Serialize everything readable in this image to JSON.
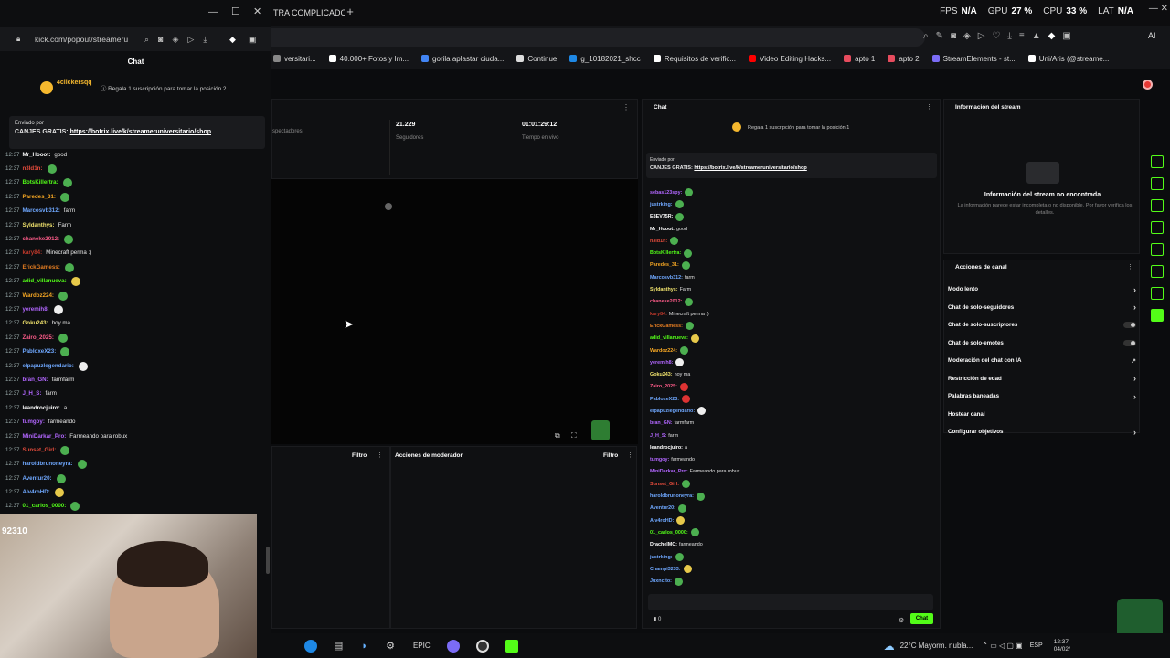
{
  "browser": {
    "tab_title": "TRA COMPLICADO",
    "new_tab": "+",
    "stats": [
      {
        "label": "FPS",
        "value": "N/A"
      },
      {
        "label": "GPU",
        "value": "27 %"
      },
      {
        "label": "CPU",
        "value": "33 %"
      },
      {
        "label": "LAT",
        "value": "N/A"
      }
    ],
    "ai_label": "AI",
    "bookmarks": [
      {
        "label": "versitari...",
        "color": "#888"
      },
      {
        "label": "40.000+ Fotos y Im...",
        "color": "#ffffff"
      },
      {
        "label": "gorila aplastar ciuda...",
        "color": "#4285f4"
      },
      {
        "label": "Continue",
        "color": "#dddddd"
      },
      {
        "label": "g_10182021_shcc",
        "color": "#1e88e5"
      },
      {
        "label": "Requisitos de verific...",
        "color": "#ffffff"
      },
      {
        "label": "Video Editing Hacks...",
        "color": "#ff0000"
      },
      {
        "label": "apto 1",
        "color": "#e74c5e"
      },
      {
        "label": "apto 2",
        "color": "#e74c5e"
      },
      {
        "label": "StreamElements - st...",
        "color": "#7b6cf6"
      },
      {
        "label": "Uni/Aris (@streame...",
        "color": "#ffffff"
      }
    ]
  },
  "popout": {
    "url": "kick.com/popout/streamerü",
    "chat_title": "Chat",
    "top_gifter": {
      "name": "4clickersqq",
      "text": "Regala 1 suscripción para tomar la posición 2"
    },
    "pinned": {
      "sent_by": "Enviado por",
      "text": "CANJES GRATIS:",
      "link": "https://botrix.live/k/streameruniversitario/shop"
    },
    "messages": [
      {
        "time": "12:37",
        "user": "Mr_Hooot:",
        "color": "#ffffff",
        "text": "good",
        "emote": ""
      },
      {
        "time": "12:37",
        "user": "n3ld1n:",
        "color": "#e74c3c",
        "text": "",
        "emote": "g"
      },
      {
        "time": "12:37",
        "user": "BotsKillertra:",
        "color": "#53fc18",
        "text": "",
        "emote": "g"
      },
      {
        "time": "12:37",
        "user": "Paredes_31:",
        "color": "#f5a623",
        "text": "",
        "emote": "g"
      },
      {
        "time": "12:37",
        "user": "Marcosvb312:",
        "color": "#6fa8ff",
        "text": "farm",
        "emote": ""
      },
      {
        "time": "12:37",
        "user": "Syldanthys:",
        "color": "#f1e36d",
        "text": "Farm",
        "emote": ""
      },
      {
        "time": "12:37",
        "user": "chaneke2012:",
        "color": "#ff5c8a",
        "text": "",
        "emote": "g"
      },
      {
        "time": "12:37",
        "user": "kary84:",
        "color": "#c0392b",
        "text": "Minecraft perma :)",
        "emote": ""
      },
      {
        "time": "12:37",
        "user": "ErickGamess:",
        "color": "#e67e22",
        "text": "",
        "emote": "g"
      },
      {
        "time": "12:37",
        "user": "adid_villanueva:",
        "color": "#53fc18",
        "text": "",
        "emote": "y"
      },
      {
        "time": "12:37",
        "user": "Wardoz224:",
        "color": "#f5a623",
        "text": "",
        "emote": "g"
      },
      {
        "time": "12:37",
        "user": "yeremih8:",
        "color": "#b266ff",
        "text": "",
        "emote": "w"
      },
      {
        "time": "12:37",
        "user": "Goku243:",
        "color": "#f1e36d",
        "text": "hoy ma",
        "emote": ""
      },
      {
        "time": "12:37",
        "user": "Zairo_2025:",
        "color": "#ff5c8a",
        "text": "",
        "emote": "g"
      },
      {
        "time": "12:37",
        "user": "PabloxeX23:",
        "color": "#6fa8ff",
        "text": "",
        "emote": "g"
      },
      {
        "time": "12:37",
        "user": "elpapuzlegendario:",
        "color": "#6fa8ff",
        "text": "",
        "emote": "w"
      },
      {
        "time": "12:37",
        "user": "bran_GN:",
        "color": "#b266ff",
        "text": "farmfarm",
        "emote": ""
      },
      {
        "time": "12:37",
        "user": "J_H_S:",
        "color": "#b266ff",
        "text": "farm",
        "emote": ""
      },
      {
        "time": "12:37",
        "user": "leandrocjuiro:",
        "color": "#ffffff",
        "text": "a",
        "emote": ""
      },
      {
        "time": "12:37",
        "user": "tumgoy:",
        "color": "#b266ff",
        "text": "farmeando",
        "emote": ""
      },
      {
        "time": "12:37",
        "user": "MiniDarkar_Pro:",
        "color": "#b266ff",
        "text": "Farmeando para robux",
        "emote": ""
      },
      {
        "time": "12:37",
        "user": "Sunset_Girl:",
        "color": "#e74c3c",
        "text": "",
        "emote": "g"
      },
      {
        "time": "12:37",
        "user": "haroldbrunoneyra:",
        "color": "#6fa8ff",
        "text": "",
        "emote": "g"
      },
      {
        "time": "12:37",
        "user": "Aventur20:",
        "color": "#6fa8ff",
        "text": "",
        "emote": "g"
      },
      {
        "time": "12:37",
        "user": "Alv4roHD:",
        "color": "#6fa8ff",
        "text": "",
        "emote": "y"
      },
      {
        "time": "12:37",
        "user": "01_carlos_0000:",
        "color": "#53fc18",
        "text": "",
        "emote": "g"
      }
    ],
    "webcam_overlay": "92310"
  },
  "dashboard": {
    "stats": [
      {
        "value": "",
        "label": "spectadores"
      },
      {
        "value": "21.229",
        "label": "Seguidores"
      },
      {
        "value": "01:01:29:12",
        "label": "Tiempo en vivo"
      }
    ],
    "filter_label": "Filtro",
    "mod_actions_title": "Acciones de moderador",
    "chat": {
      "title": "Chat",
      "gift_text": "Regala 1 suscripción para tomar la posición 1",
      "pinned_sent_by": "Enviado por",
      "pinned_text": "CANJES GRATIS:",
      "pinned_link": "https://botrix.live/k/streameruniversitario/shop",
      "messages": [
        {
          "user": "sebas123spy:",
          "color": "#b266ff",
          "text": "",
          "emote": "g"
        },
        {
          "user": "justrking:",
          "color": "#6fa8ff",
          "text": "",
          "emote": "g"
        },
        {
          "user": "E8EV75R:",
          "color": "#ffffff",
          "text": "",
          "emote": "g"
        },
        {
          "user": "Mr_Hooot:",
          "color": "#ffffff",
          "text": "good",
          "emote": ""
        },
        {
          "user": "n3ld1n:",
          "color": "#e74c3c",
          "text": "",
          "emote": "g"
        },
        {
          "user": "BotsKillertra:",
          "color": "#53fc18",
          "text": "",
          "emote": "g"
        },
        {
          "user": "Paredes_31:",
          "color": "#f5a623",
          "text": "",
          "emote": "g"
        },
        {
          "user": "Marcosvb312:",
          "color": "#6fa8ff",
          "text": "farm",
          "emote": ""
        },
        {
          "user": "Syldanthys:",
          "color": "#f1e36d",
          "text": "Farm",
          "emote": ""
        },
        {
          "user": "chaneke2012:",
          "color": "#ff5c8a",
          "text": "",
          "emote": "g"
        },
        {
          "user": "kary84:",
          "color": "#c0392b",
          "text": "Minecraft perma :)",
          "emote": ""
        },
        {
          "user": "ErickGamess:",
          "color": "#e67e22",
          "text": "",
          "emote": "g"
        },
        {
          "user": "adid_villanueva:",
          "color": "#53fc18",
          "text": "",
          "emote": "y"
        },
        {
          "user": "Wardoz224:",
          "color": "#f5a623",
          "text": "",
          "emote": "g"
        },
        {
          "user": "yeremih8:",
          "color": "#b266ff",
          "text": "",
          "emote": "w"
        },
        {
          "user": "Goku243:",
          "color": "#f1e36d",
          "text": "hoy ma",
          "emote": ""
        },
        {
          "user": "Zairo_2025:",
          "color": "#ff5c8a",
          "text": "",
          "emote": "r"
        },
        {
          "user": "PabloxeX23:",
          "color": "#6fa8ff",
          "text": "",
          "emote": "r"
        },
        {
          "user": "elpapuzlegendario:",
          "color": "#6fa8ff",
          "text": "",
          "emote": "w"
        },
        {
          "user": "bran_GN:",
          "color": "#b266ff",
          "text": "farmfarm",
          "emote": ""
        },
        {
          "user": "J_H_S:",
          "color": "#b266ff",
          "text": "farm",
          "emote": ""
        },
        {
          "user": "leandrocjuiro:",
          "color": "#ffffff",
          "text": "a",
          "emote": ""
        },
        {
          "user": "tumgoy:",
          "color": "#b266ff",
          "text": "farmeando",
          "emote": ""
        },
        {
          "user": "MiniDarkar_Pro:",
          "color": "#b266ff",
          "text": "Farmeando para robux",
          "emote": ""
        },
        {
          "user": "Sunset_Girl:",
          "color": "#e74c3c",
          "text": "",
          "emote": "g"
        },
        {
          "user": "haroldbrunoneyra:",
          "color": "#6fa8ff",
          "text": "",
          "emote": "g"
        },
        {
          "user": "Aventur20:",
          "color": "#6fa8ff",
          "text": "",
          "emote": "g"
        },
        {
          "user": "Alv4roHD:",
          "color": "#6fa8ff",
          "text": "",
          "emote": "y"
        },
        {
          "user": "01_carlos_0000:",
          "color": "#53fc18",
          "text": "",
          "emote": "g"
        },
        {
          "user": "DrachelMC:",
          "color": "#ffffff",
          "text": "farmeando",
          "emote": ""
        },
        {
          "user": "justrking:",
          "color": "#6fa8ff",
          "text": "",
          "emote": "g"
        },
        {
          "user": "Champi3233:",
          "color": "#6fa8ff",
          "text": "",
          "emote": "y"
        },
        {
          "user": "Juxnclto:",
          "color": "#6fa8ff",
          "text": "",
          "emote": "g"
        }
      ],
      "count": "0",
      "send_button": "Chat"
    },
    "stream_info": {
      "title": "Información del stream",
      "not_found": "Información del stream no encontrada",
      "desc": "La información parece estar incompleta o no disponible. Por favor verifica los detalles."
    },
    "channel_actions": {
      "title": "Acciones de canal",
      "items": [
        {
          "label": "Modo lento",
          "control": "arrow"
        },
        {
          "label": "Chat de solo-seguidores",
          "control": "arrow"
        },
        {
          "label": "Chat de solo-suscriptores",
          "control": "toggle"
        },
        {
          "label": "Chat de solo-emotes",
          "control": "toggle"
        },
        {
          "label": "Moderación del chat con IA",
          "control": "link"
        },
        {
          "label": "Restricción de edad",
          "control": "arrow"
        },
        {
          "label": "Palabras baneadas",
          "control": "arrow"
        },
        {
          "label": "Hostear canal",
          "control": ""
        },
        {
          "label": "Configurar objetivos",
          "control": "arrow"
        }
      ]
    }
  },
  "taskbar": {
    "weather": "22°C  Mayorm. nubla...",
    "lang": "ESP",
    "time": "12:37",
    "date": "04/02/"
  },
  "colors": {
    "accent": "#53fc18",
    "bg": "#0b0c0e",
    "panel": "#0f1012"
  }
}
